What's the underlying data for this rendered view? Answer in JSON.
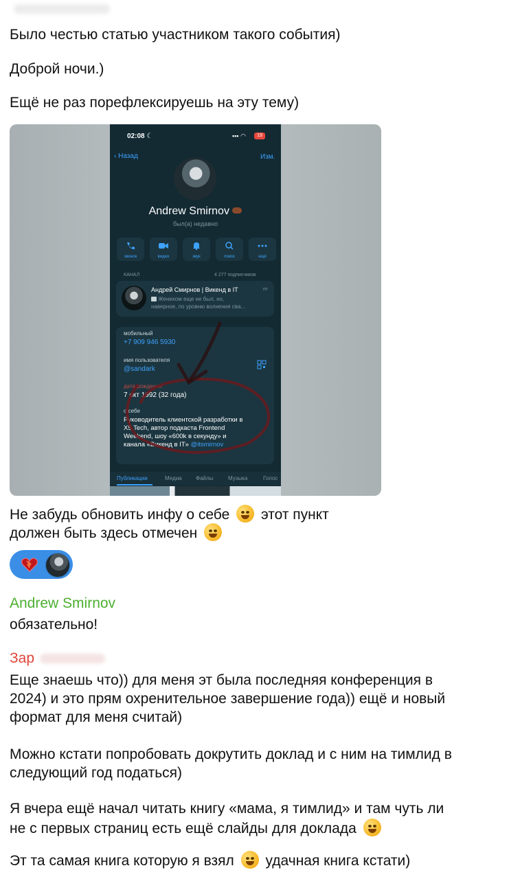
{
  "messages_top": [
    "Было честью статью участником такого события)",
    "Доброй ночи.)",
    "Ещё не раз порефлексируешь на эту тему)"
  ],
  "phone": {
    "time": "02:08",
    "battery": "19",
    "back_label": "Назад",
    "edit_label": "Изм.",
    "name": "Andrew Smirnov",
    "last_seen": "был(а) недавно",
    "actions": [
      "звонок",
      "видео",
      "звук",
      "поиск",
      "ещё"
    ],
    "channel_header": "КАНАЛ",
    "subscribers": "4 277 подписчиков",
    "channel_title": "Андрей Смирнов | Викенд в IT",
    "channel_time": "пт",
    "channel_preview_1": "Женихом еще не был, но,",
    "channel_preview_2": "наверное, по уровню волнения сва...",
    "mobile_label": "мобильный",
    "mobile_value": "+7 909 946 5930",
    "username_label": "имя пользователя",
    "username_value": "@sandark",
    "birthday_label": "дата рождения",
    "birthday_value": "7 окт 1992 (32 года)",
    "about_label": "о себе",
    "about_lines": [
      "Руководитель клиентской разработки в",
      "X5 Tech, автор подкаста Frontend",
      "Weekend, шоу «600k в секунду» и",
      "канала «Викенд в IT»"
    ],
    "about_link": "@itsmirnov",
    "tabs": [
      "Публикации",
      "Медиа",
      "Файлы",
      "Музыка",
      "Голос"
    ]
  },
  "message_mid_1": "Не забудь обновить инфу о себе",
  "message_mid_1b": "этот пункт",
  "message_mid_2": "должен быть здесь отмечен",
  "reply_sender": "Andrew Smirnov",
  "reply_text": "обязательно!",
  "second_sender": "Зар",
  "long_message": [
    "Еще знаешь что)) для меня эт была последняя конференция в",
    "2024) и это прям охренительное завершение года)) ещё и новый",
    "формат для меня считай)",
    "Можно кстати попробовать докрутить доклад и с ним на тимлид в",
    "следующий год податься)",
    "Я вчера ещё начал читать книгу «мама, я тимлид» и там чуть ли",
    "не с первых страниц есть ещё слайды для доклада",
    "Эт та самая книга которую я взял",
    "удачная книга кстати)"
  ],
  "colors": {
    "sender_green": "#4caf30",
    "sender_red": "#e0453a",
    "reaction_bg": "#3a8ee6",
    "phone_bg": "#132a33",
    "link_blue": "#3ea2ff"
  }
}
